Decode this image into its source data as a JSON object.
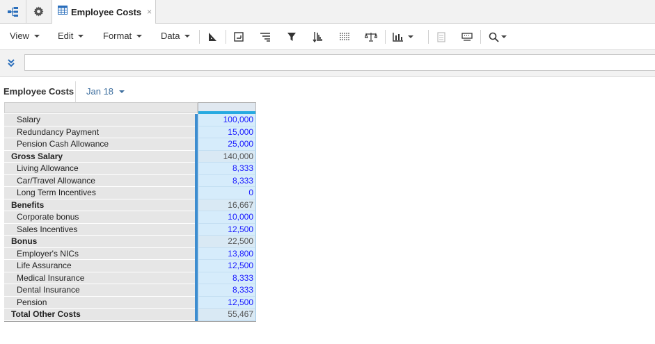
{
  "tabs": {
    "active_title": "Employee Costs",
    "close_glyph": "×",
    "icons": [
      "hierarchy-icon",
      "gear-icon",
      "grid-icon"
    ]
  },
  "toolbar": {
    "menus": [
      "View",
      "Edit",
      "Format",
      "Data"
    ]
  },
  "formula_bar": {
    "value": ""
  },
  "header": {
    "title": "Employee Costs",
    "period": "Jan 18"
  },
  "grid": {
    "rows": [
      {
        "label": "Salary",
        "value": "100,000",
        "total": false
      },
      {
        "label": "Redundancy Payment",
        "value": "15,000",
        "total": false
      },
      {
        "label": "Pension Cash Allowance",
        "value": "25,000",
        "total": false
      },
      {
        "label": "Gross Salary",
        "value": "140,000",
        "total": true
      },
      {
        "label": "Living Allowance",
        "value": "8,333",
        "total": false
      },
      {
        "label": "Car/Travel Allowance",
        "value": "8,333",
        "total": false
      },
      {
        "label": "Long Term Incentives",
        "value": "0",
        "total": false
      },
      {
        "label": "Benefits",
        "value": "16,667",
        "total": true
      },
      {
        "label": "Corporate bonus",
        "value": "10,000",
        "total": false
      },
      {
        "label": "Sales Incentives",
        "value": "12,500",
        "total": false
      },
      {
        "label": "Bonus",
        "value": "22,500",
        "total": true
      },
      {
        "label": "Employer's NICs",
        "value": "13,800",
        "total": false
      },
      {
        "label": "Life Assurance",
        "value": "12,500",
        "total": false
      },
      {
        "label": "Medical Insurance",
        "value": "8,333",
        "total": false
      },
      {
        "label": "Dental Insurance",
        "value": "8,333",
        "total": false
      },
      {
        "label": "Pension",
        "value": "12,500",
        "total": false
      },
      {
        "label": "Total Other Costs",
        "value": "55,467",
        "total": true
      }
    ]
  },
  "colors": {
    "accent": "#27aae1",
    "input_value": "#1a1aff",
    "link": "#3d6e9e"
  }
}
